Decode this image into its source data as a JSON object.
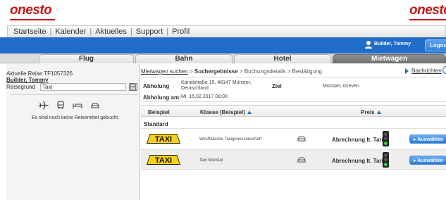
{
  "header": {
    "logo_left": "onesto",
    "logo_right": "onesto",
    "brand_color": "#c81414"
  },
  "topnav": {
    "items": [
      "Startseite",
      "Kalender",
      "Aktuelles",
      "Support",
      "Profil"
    ],
    "separator": "|"
  },
  "userbar": {
    "user_name": "Builder, Tommy",
    "logout_label": "Logout",
    "bar_color": "#1f6dc8"
  },
  "tabs": [
    {
      "label": "Flug",
      "active": false
    },
    {
      "label": "Bahn",
      "active": false
    },
    {
      "label": "Hotel",
      "active": false
    },
    {
      "label": "Mietwagen",
      "active": true
    }
  ],
  "sidebar": {
    "current_trip": "Aktuelle Reise TF1057326",
    "traveler": "Builder, Tommy",
    "reason_label": "Reisegrund",
    "reason_value": "Taxi",
    "icons": [
      "plane-icon",
      "train-icon",
      "hotel-icon",
      "car-icon"
    ],
    "empty_message": "Es sind noch keine Reisemittel gebucht."
  },
  "breadcrumb": {
    "step1": "Mietwagen suchen",
    "sep": ">",
    "step2": "Suchergebnisse",
    "step3": "Buchungsdetails",
    "step4": "Bestätigung"
  },
  "news_label": "Nachrichten",
  "pickup": {
    "pickup_label": "Abholung",
    "pickup_address_line1": "Kanalstraße 15, 48147 Münster,",
    "pickup_address_line2": "Deutschland",
    "destination_label": "Ziel",
    "destination_value": "Münster, Greven",
    "time_label": "Abholung am:",
    "time_value": "Mi, 15.02.2017 08:00"
  },
  "table": {
    "col_example": "Beispiel",
    "col_class": "Klasse (Beispiel)",
    "col_price": "Preis",
    "group_label": "Standard",
    "rows": [
      {
        "badge": "TAXI",
        "company": "Westfälische Taxigenossenschaft",
        "rate": "Abrechnung lt. Tarif",
        "button": "Auswählen"
      },
      {
        "badge": "TAXI",
        "company": "Taxi Münster",
        "rate": "Abrechnung lt. Tarif",
        "button": "Auswählen"
      }
    ]
  }
}
